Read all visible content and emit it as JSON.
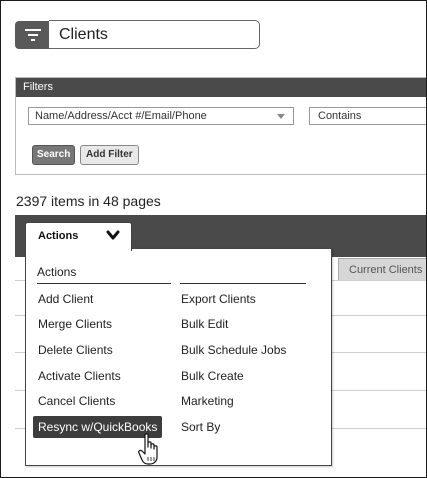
{
  "header": {
    "title": "Clients",
    "menu_icon": "filter-lines-icon"
  },
  "filters": {
    "heading": "Filters",
    "field_value": "Name/Address/Acct #/Email/Phone",
    "operator_value": "Contains",
    "search_label": "Search",
    "add_filter_label": "Add Filter"
  },
  "results": {
    "count_text": "2397 items in 48 pages"
  },
  "tabs": {
    "current_clients": "Current Clients"
  },
  "actions": {
    "trigger_label": "Actions",
    "menu_header": "Actions",
    "left_items": [
      "Add Client",
      "Merge Clients",
      "Delete Clients",
      "Activate Clients",
      "Cancel Clients",
      "Resync w/QuickBooks"
    ],
    "right_items": [
      "Export Clients",
      "Bulk Edit",
      "Bulk Schedule Jobs",
      "Bulk Create",
      "Marketing",
      "Sort By"
    ],
    "highlighted_item": "Resync w/QuickBooks"
  },
  "colors": {
    "dark_bar": "#4a4a4a",
    "highlight": "#3d3d3d",
    "button": "#595959"
  }
}
